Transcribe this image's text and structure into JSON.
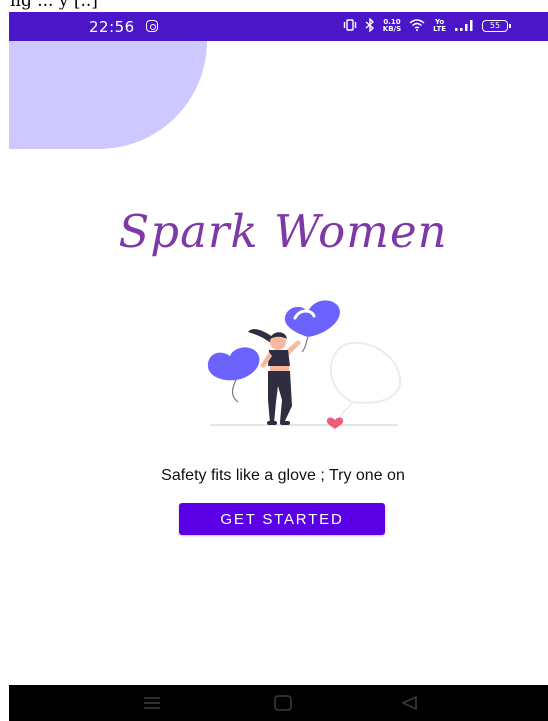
{
  "top_crop_text": "ng ... y [..]",
  "status_bar": {
    "time": "22:56",
    "speed_value": "0.10",
    "speed_unit": "KB/S",
    "net_top": "Yo",
    "net_bottom": "LTE",
    "battery": "55",
    "background_color": "#4a16c8"
  },
  "app": {
    "title": "Spark Women",
    "tagline": "Safety fits like a glove ; Try one on",
    "cta_label": "GET STARTED",
    "title_color": "#7d3aa6",
    "accent_color": "#5b00e6",
    "blob_color": "#cdc8ff",
    "heart_color": "#6c63ff",
    "illustration": "woman-with-heart-balloons-illustration"
  },
  "nav_bar": {
    "menu_icon": "menu-icon",
    "home_icon": "home-square-icon",
    "back_icon": "back-triangle-icon"
  }
}
